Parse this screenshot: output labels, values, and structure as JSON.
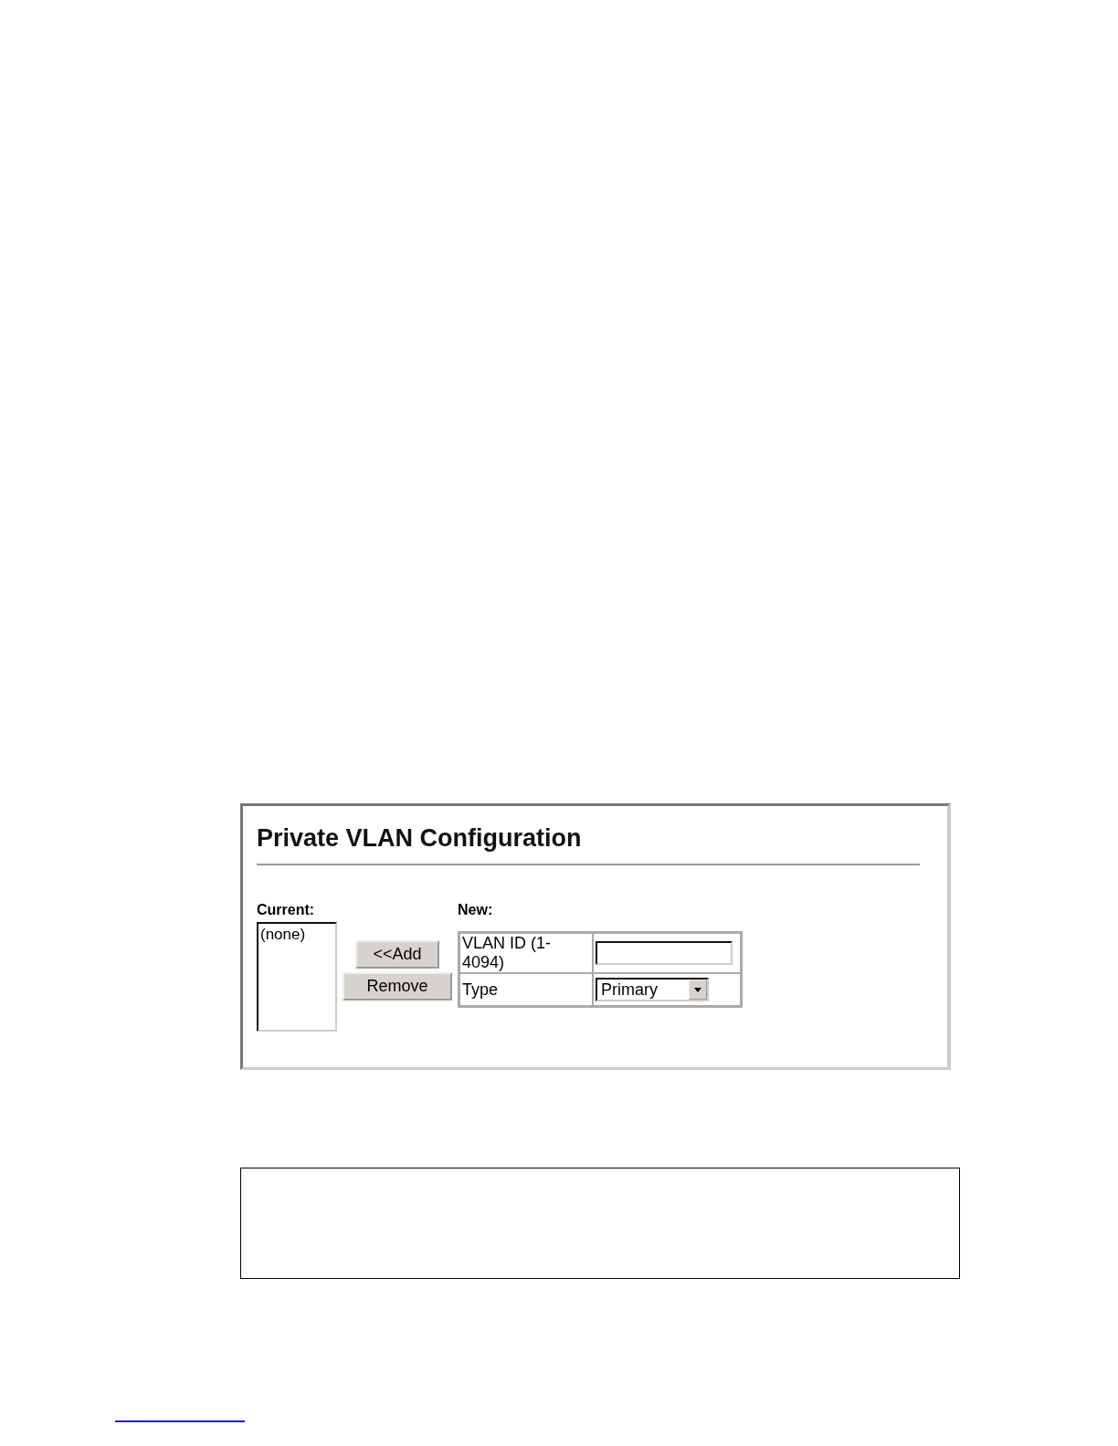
{
  "panel": {
    "title": "Private VLAN Configuration",
    "current": {
      "label": "Current:",
      "items": [
        "(none)"
      ]
    },
    "buttons": [
      "<<Add",
      "Remove"
    ],
    "new": {
      "label": "New:",
      "rows": [
        {
          "kind": "input",
          "label": "VLAN ID (1-4094)"
        },
        {
          "kind": "select",
          "label": "Type",
          "value": "Primary"
        }
      ]
    }
  }
}
